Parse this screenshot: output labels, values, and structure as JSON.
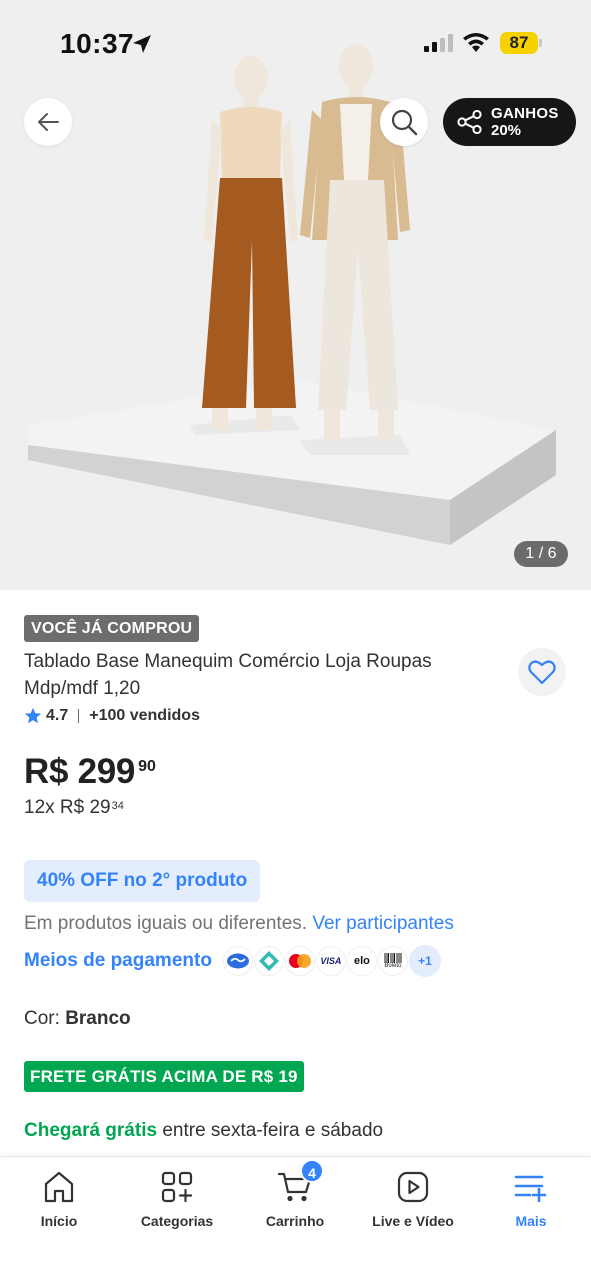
{
  "status_bar": {
    "time": "10:37",
    "battery": "87"
  },
  "header": {
    "share_line1": "GANHOS",
    "share_line2": "20%"
  },
  "gallery": {
    "counter": "1 / 6"
  },
  "product": {
    "bought_badge": "VOCÊ JÁ COMPROU",
    "title": "Tablado Base Manequim Comércio Loja Roupas Mdp/mdf 1,20",
    "rating": "4.7",
    "sold": "+100 vendidos",
    "price_main": "R$ 299",
    "price_cents": "90",
    "installments_main": "12x R$ 29",
    "installments_cents": "34"
  },
  "promo": {
    "badge": "40% OFF no 2° produto",
    "sub_text": "Em produtos iguais ou diferentes.",
    "sub_link": "Ver participantes"
  },
  "payments": {
    "label": "Meios de pagamento",
    "methods": [
      "mercado-pago-icon",
      "pix-icon",
      "mastercard-icon",
      "visa-icon",
      "elo-icon",
      "boleto-icon"
    ],
    "visa": "VISA",
    "elo": "elo",
    "boleto": "Boleto",
    "more": "+1"
  },
  "variation": {
    "label": "Cor:",
    "value": "Branco"
  },
  "shipping": {
    "badge": "FRETE GRÁTIS ACIMA DE R$ 19",
    "arrival_green": "Chegará grátis",
    "arrival_rest": "entre sexta-feira e sábado"
  },
  "bottom_nav": {
    "items": [
      {
        "label": "Início",
        "icon": "home-icon"
      },
      {
        "label": "Categorias",
        "icon": "categories-icon"
      },
      {
        "label": "Carrinho",
        "icon": "cart-icon",
        "badge": "4"
      },
      {
        "label": "Live e Vídeo",
        "icon": "play-icon"
      },
      {
        "label": "Mais",
        "icon": "menu-plus-icon",
        "active": true
      }
    ]
  },
  "colors": {
    "accent_blue": "#3483fa",
    "green": "#00a650",
    "battery_yellow": "#f5d200"
  }
}
